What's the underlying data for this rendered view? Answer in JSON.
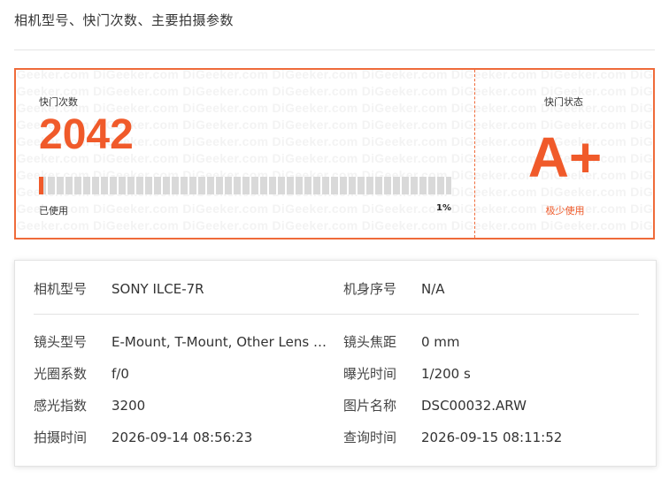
{
  "section_title": "相机型号、快门次数、主要拍摄参数",
  "watermark_text": "DiGeeker.com",
  "shutter": {
    "count_label": "快门次数",
    "count_value": "2042",
    "used_label": "已使用",
    "used_percent_text": "1%",
    "used_fraction": 0.01,
    "status_label": "快门状态",
    "grade": "A+",
    "grade_desc": "极少使用",
    "accent_color": "#f05a2a"
  },
  "params": {
    "camera_model_label": "相机型号",
    "camera_model": "SONY ILCE-7R",
    "serial_label": "机身序号",
    "serial": "N/A",
    "lens_model_label": "镜头型号",
    "lens_model": "E-Mount, T-Mount, Other Lens or no lens",
    "focal_length_label": "镜头焦距",
    "focal_length": "0 mm",
    "aperture_label": "光圈系数",
    "aperture": "f/0",
    "exposure_label": "曝光时间",
    "exposure": "1/200 s",
    "iso_label": "感光指数",
    "iso": "3200",
    "filename_label": "图片名称",
    "filename": "DSC00032.ARW",
    "shot_time_label": "拍摄时间",
    "shot_time": "2026-09-14 08:56:23",
    "query_time_label": "查询时间",
    "query_time": "2026-09-15 08:11:52"
  }
}
